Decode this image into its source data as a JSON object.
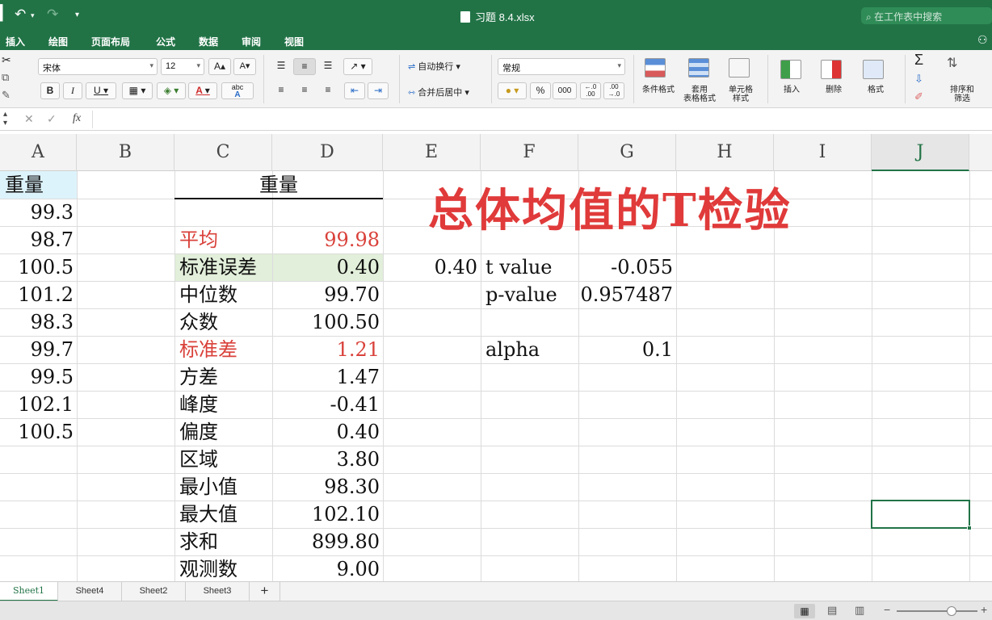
{
  "app": {
    "doc_title": "习题 8.4.xlsx",
    "search_placeholder": "在工作表中搜索"
  },
  "menu_tabs": [
    "插入",
    "绘图",
    "页面布局",
    "公式",
    "数据",
    "审阅",
    "视图"
  ],
  "ribbon": {
    "font_name": "宋体",
    "font_size": "12",
    "grow_font": "A",
    "shrink_font": "A",
    "bold": "B",
    "italic": "I",
    "underline": "U",
    "font_color": "A",
    "phonetic": "abc",
    "wrap_text": "自动换行",
    "merge_center": "合并后居中",
    "number_format": "常规",
    "percent": "%",
    "comma": "000",
    "conditional_format": "条件格式",
    "table_format": "套用\n表格格式",
    "cell_style": "单元格\n样式",
    "insert": "插入",
    "delete": "删除",
    "format": "格式",
    "sort_filter": "排序和\n筛选"
  },
  "formula_bar": {
    "fx": "fx"
  },
  "columns": [
    "A",
    "B",
    "C",
    "D",
    "E",
    "F",
    "G",
    "H",
    "I",
    "J"
  ],
  "sheet": {
    "title_overlay": "总体均值的T检验",
    "colA_header": "重量",
    "colA_values": [
      "99.3",
      "98.7",
      "100.5",
      "101.2",
      "98.3",
      "99.7",
      "99.5",
      "102.1",
      "100.5"
    ],
    "stats_header": "重量",
    "stats": [
      {
        "label": "平均",
        "value": "99.98",
        "red": true
      },
      {
        "label": "标准误差",
        "value": "0.40",
        "red": false
      },
      {
        "label": "中位数",
        "value": "99.70",
        "red": false
      },
      {
        "label": "众数",
        "value": "100.50",
        "red": false
      },
      {
        "label": "标准差",
        "value": "1.21",
        "red": true
      },
      {
        "label": "方差",
        "value": "1.47",
        "red": false
      },
      {
        "label": "峰度",
        "value": "-0.41",
        "red": false
      },
      {
        "label": "偏度",
        "value": "0.40",
        "red": false
      },
      {
        "label": "区域",
        "value": "3.80",
        "red": false
      },
      {
        "label": "最小值",
        "value": "98.30",
        "red": false
      },
      {
        "label": "最大值",
        "value": "102.10",
        "red": false
      },
      {
        "label": "求和",
        "value": "899.80",
        "red": false
      },
      {
        "label": "观测数",
        "value": "9.00",
        "red": false
      }
    ],
    "e_value": "0.40",
    "t_label": "t value",
    "t_value": "-0.055",
    "p_label": "p-value",
    "p_value": "0.957487",
    "alpha_label": "alpha",
    "alpha_value": "0.1"
  },
  "sheet_tabs": [
    "Sheet1",
    "Sheet4",
    "Sheet2",
    "Sheet3"
  ],
  "add_sheet": "+",
  "colors": {
    "excel_green": "#217346",
    "red_text": "#d9413a",
    "highlight_green": "#e2efda",
    "highlight_cyan": "#ddf3fb"
  }
}
